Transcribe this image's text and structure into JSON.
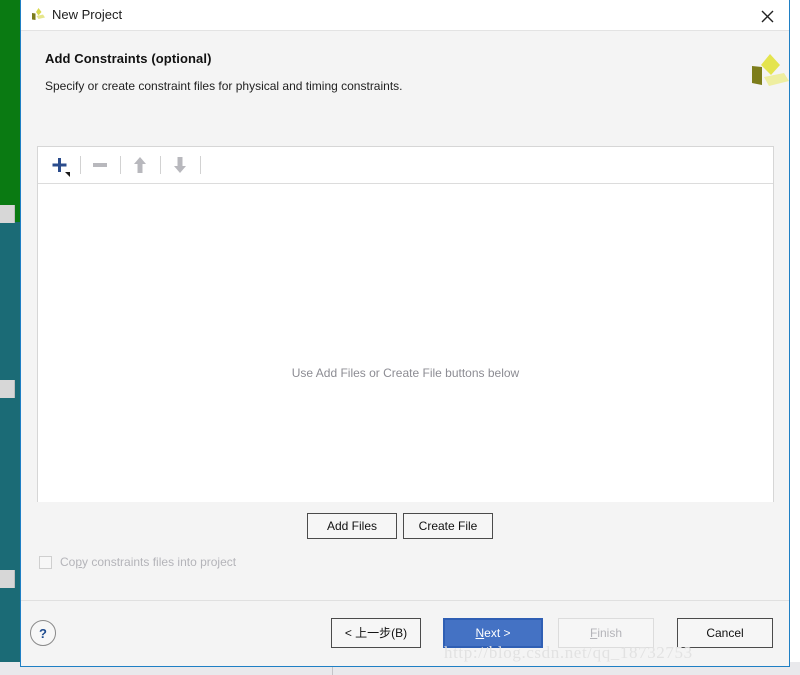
{
  "window": {
    "title": "New Project",
    "icon": "xilinx-logo-icon",
    "close_label": "×"
  },
  "header": {
    "title": "Add Constraints (optional)",
    "subtitle": "Specify or create constraint files for physical and timing constraints.",
    "logo": "xilinx-pinwheel-logo"
  },
  "file_panel": {
    "toolbar": [
      {
        "name": "add-sources-button",
        "icon": "plus-icon",
        "enabled": true,
        "has_dropdown": true,
        "color": "#2b4c8c"
      },
      {
        "name": "remove-button",
        "icon": "minus-icon",
        "enabled": false,
        "color": "#b8b8bd"
      },
      {
        "name": "move-up-button",
        "icon": "arrow-up-icon",
        "enabled": false,
        "color": "#b8b8bd"
      },
      {
        "name": "move-down-button",
        "icon": "arrow-down-icon",
        "enabled": false,
        "color": "#b8b8bd"
      }
    ],
    "empty_hint": "Use Add Files or Create File buttons below"
  },
  "actions": {
    "add_files_label": "Add Files",
    "create_file_label": "Create File"
  },
  "options": {
    "copy_constraints": {
      "label_before": "Co",
      "label_mnemonic": "p",
      "label_after": "y constraints files into project",
      "checked": false,
      "enabled": false
    }
  },
  "footer": {
    "help_label": "?",
    "back_label": "< 上一步(B)",
    "back_mnemonic": "B",
    "next_label_before": "",
    "next_mnemonic": "N",
    "next_label_after": "ext >",
    "finish_mnemonic": "F",
    "finish_label_after": "inish",
    "cancel_label": "Cancel"
  },
  "watermark": "http://blog.csdn.net/qq_18732753",
  "colors": {
    "accent_blue": "#1f7fc4",
    "default_button_blue": "#4472c4",
    "brand_yellow": "#d8d84a",
    "brand_olive": "#7a7a18",
    "desktop_green": "#0a7a12",
    "desktop_teal": "#1b6b76"
  }
}
